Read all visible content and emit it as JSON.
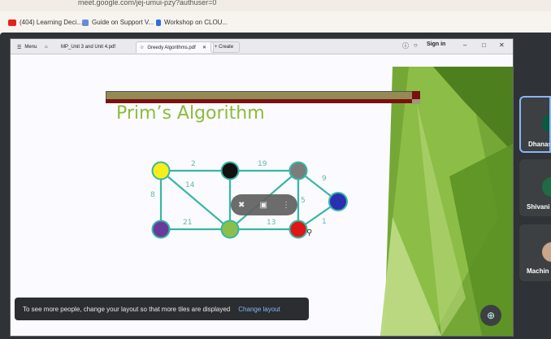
{
  "browser": {
    "url": "meet.google.com/jej-umui-pzy?authuser=0",
    "bookmarks": [
      {
        "label": "(404) Learning Deci...",
        "icon": "youtube-icon",
        "color": "#e62117"
      },
      {
        "label": "Guide on Support V...",
        "icon": "chart-icon",
        "color": "#6a8ad8"
      },
      {
        "label": "Workshop on CLOU...",
        "icon": "pen-icon",
        "color": "#2a6fdb"
      }
    ]
  },
  "viewer": {
    "menu_label": "Menu",
    "tabs": [
      {
        "label": "MP_Unit 3 and Unit 4.pdf"
      },
      {
        "label": "Greedy Algorithms.pdf"
      }
    ],
    "create_label": "+ Create",
    "sign_in_label": "Sign in"
  },
  "slide": {
    "title": "Prim’s Algorithm",
    "edge_weights": [
      "2",
      "19",
      "9",
      "14",
      "8",
      "5",
      "21",
      "13",
      "1"
    ]
  },
  "participants": [
    {
      "name": "Dhanas",
      "color": "#0b5a3e"
    },
    {
      "name": "Shivani",
      "color": "#1f6b47"
    },
    {
      "name": "Machin",
      "color": "#c9a58a"
    }
  ],
  "toast": {
    "message": "To see more people, change your layout so that more tiles are displayed",
    "action": "Change layout"
  }
}
